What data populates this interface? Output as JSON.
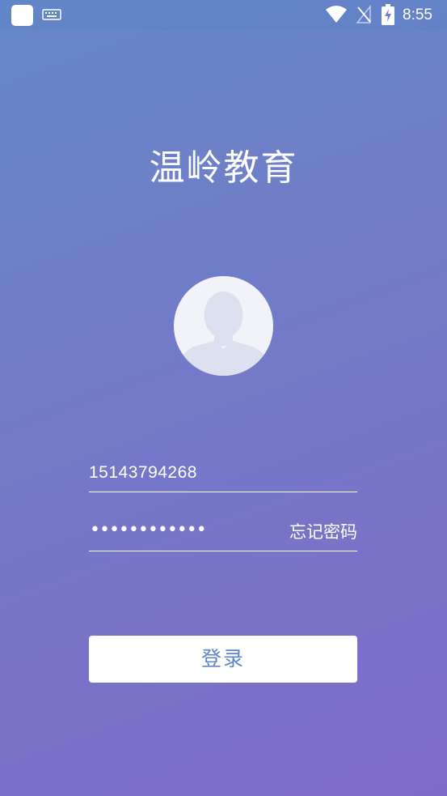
{
  "status_bar": {
    "time": "8:55",
    "icons": [
      "app-icon",
      "keyboard-icon",
      "wifi-icon",
      "signal-off-icon",
      "battery-charging-icon"
    ]
  },
  "login": {
    "title": "温岭教育",
    "username_value": "15143794268",
    "password_mask": "••••••••••••",
    "forgot_password_label": "忘记密码",
    "login_button_label": "登录"
  },
  "colors": {
    "background_top": "#6688c8",
    "background_bottom": "#7e6bc9",
    "button_text": "#5d87c4",
    "avatar_bg": "#f2f3f8",
    "avatar_silhouette": "#dde0ee"
  }
}
